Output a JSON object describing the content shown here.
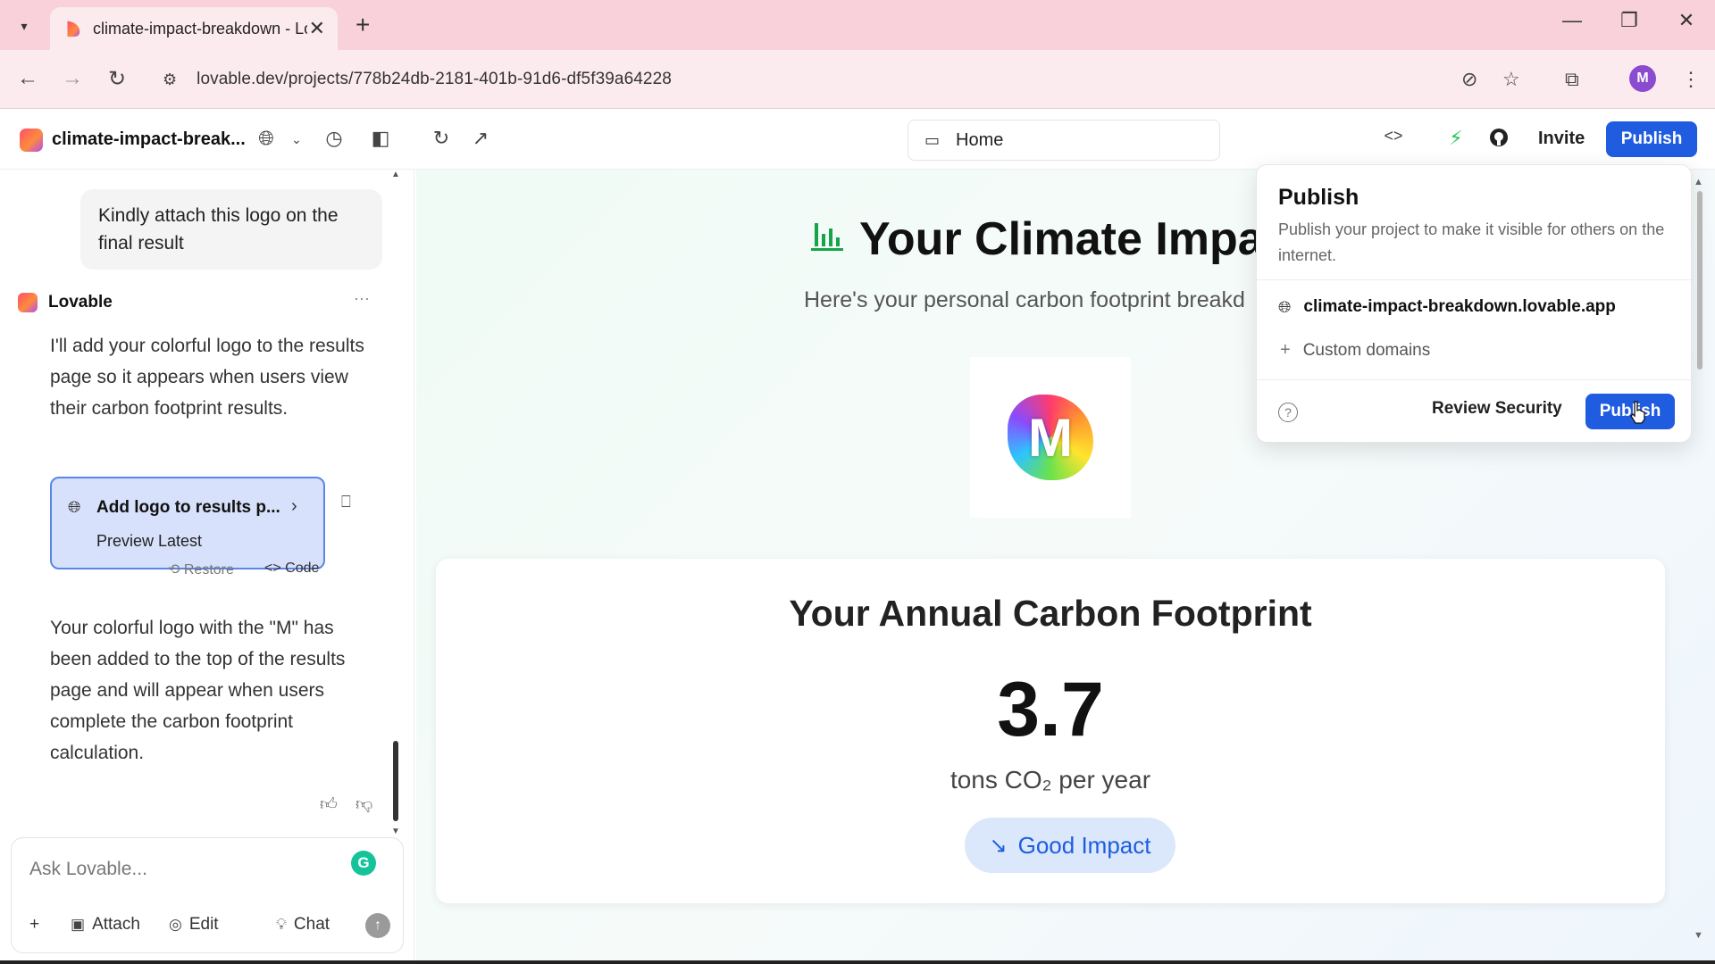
{
  "browser": {
    "tab_title": "climate-impact-breakdown - Lo",
    "url": "lovable.dev/projects/778b24db-2181-401b-91d6-df5f39a64228",
    "profile_initial": "M",
    "icons": {
      "tab_list": "chevron-down-icon",
      "close_tab": "close-icon",
      "new_tab": "plus-icon",
      "back": "arrow-left-icon",
      "forward": "arrow-right-icon",
      "reload": "reload-icon",
      "site_info": "tune-icon",
      "eye_off": "eye-off-icon",
      "bookmark": "star-icon",
      "extensions": "puzzle-icon",
      "menu": "kebab-icon"
    }
  },
  "app_header": {
    "project_name": "climate-impact-break...",
    "route": "Home",
    "invite_label": "Invite",
    "publish_label": "Publish"
  },
  "chat": {
    "user_message": "Kindly attach this logo on the final result",
    "assistant_name": "Lovable",
    "assistant_message_1": "I'll add your colorful logo to the results page so it appears when users view their carbon footprint results.",
    "version_card": {
      "title": "Add logo to results p...",
      "subtitle": "Preview Latest",
      "restore_label": "Restore",
      "code_label": "Code"
    },
    "assistant_message_2": "Your colorful logo with the \"M\" has been added to the top of the results page and will appear when users complete the carbon footprint calculation.",
    "composer": {
      "placeholder": "Ask Lovable...",
      "attach_label": "Attach",
      "edit_label": "Edit",
      "chat_label": "Chat"
    }
  },
  "preview": {
    "title": "Your Climate Impac",
    "subtitle": "Here's your personal carbon footprint breakd",
    "logo_letter": "M",
    "card": {
      "title": "Your Annual Carbon Footprint",
      "value": "3.7",
      "unit": "tons CO₂ per year",
      "badge": "Good Impact"
    }
  },
  "publish_popover": {
    "title": "Publish",
    "description": "Publish your project to make it visible for others on the internet.",
    "domain": "climate-impact-breakdown.lovable.app",
    "custom_domains_label": "Custom domains",
    "review_security_label": "Review Security",
    "publish_label": "Publish"
  },
  "colors": {
    "accent": "#1f5ce0",
    "tabbar": "#f9d1da",
    "chart_icon": "#16a34a"
  }
}
